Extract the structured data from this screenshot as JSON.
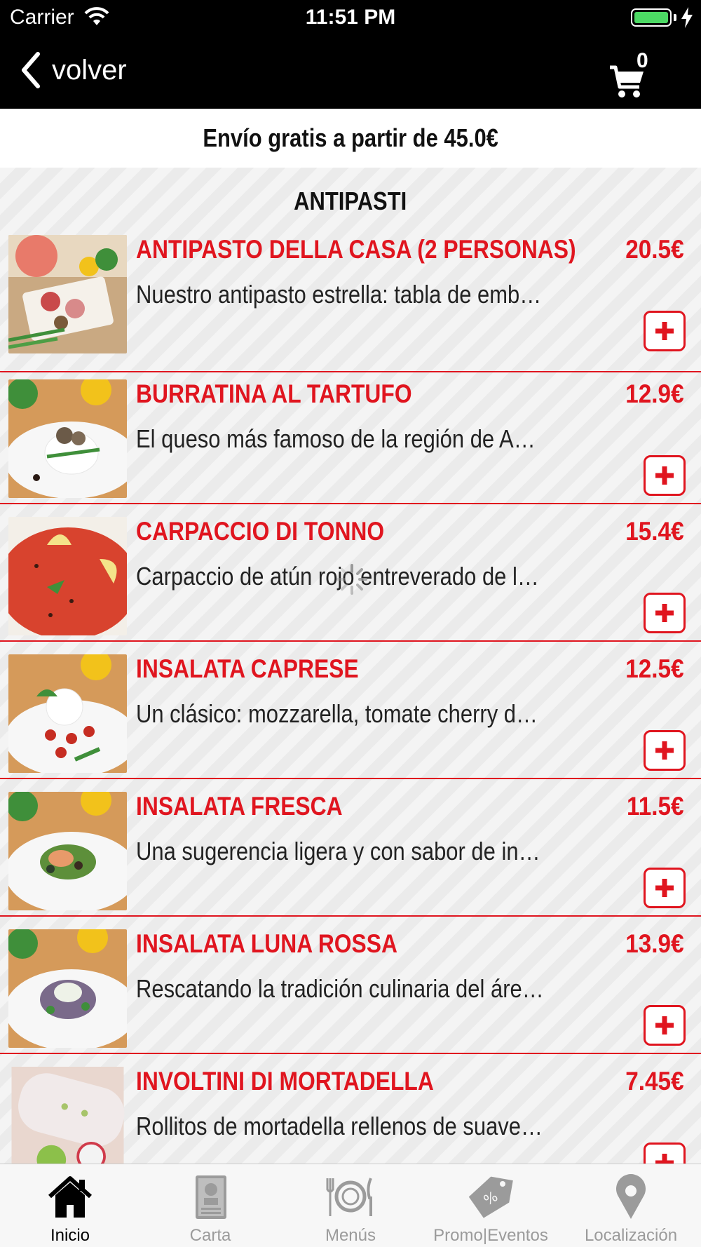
{
  "status_bar": {
    "carrier": "Carrier",
    "time": "11:51 PM",
    "battery_level": 1.0
  },
  "nav": {
    "back_label": "volver",
    "cart_count": "0"
  },
  "banner": {
    "shipping_text": "Envío gratis a partir de 45.0€"
  },
  "section": {
    "title": "ANTIPASTI"
  },
  "products": [
    {
      "name": "ANTIPASTO DELLA CASA (2 PERSONAS)",
      "price": "20.5€",
      "description": "Nuestro antipasto estrella: tabla de embutido…"
    },
    {
      "name": "BURRATINA AL TARTUFO",
      "price": "12.9€",
      "description": "El queso más famoso de la región de Apulia:…"
    },
    {
      "name": "CARPACCIO DI TONNO",
      "price": "15.4€",
      "description": "Carpaccio de atún rojo entreverado de la máx…"
    },
    {
      "name": "INSALATA CAPRESE",
      "price": "12.5€",
      "description": "Un clásico: mozzarella, tomate cherry datterin…"
    },
    {
      "name": "INSALATA FRESCA",
      "price": "11.5€",
      "description": "Una sugerencia ligera y con sabor de ingredi…"
    },
    {
      "name": "INSALATA LUNA ROSSA",
      "price": "13.9€",
      "description": "Rescatando la tradición culinaria del área del…"
    },
    {
      "name": "INVOLTINI DI MORTADELLA",
      "price": "7.45€",
      "description": "Rollitos de mortadella rellenos de suave crem…"
    }
  ],
  "tabs": [
    {
      "label": "Inicio",
      "icon": "home-icon",
      "active": true
    },
    {
      "label": "Carta",
      "icon": "menu-card-icon",
      "active": false
    },
    {
      "label": "Menús",
      "icon": "dishes-icon",
      "active": false
    },
    {
      "label": "Promo|Eventos",
      "icon": "tag-percent-icon",
      "active": false
    },
    {
      "label": "Localización",
      "icon": "location-pin-icon",
      "active": false
    }
  ],
  "colors": {
    "accent": "#e0151f",
    "header_bg": "#000000",
    "tab_active": "#000000",
    "tab_inactive": "#9b9b9b",
    "battery": "#4cd964"
  }
}
